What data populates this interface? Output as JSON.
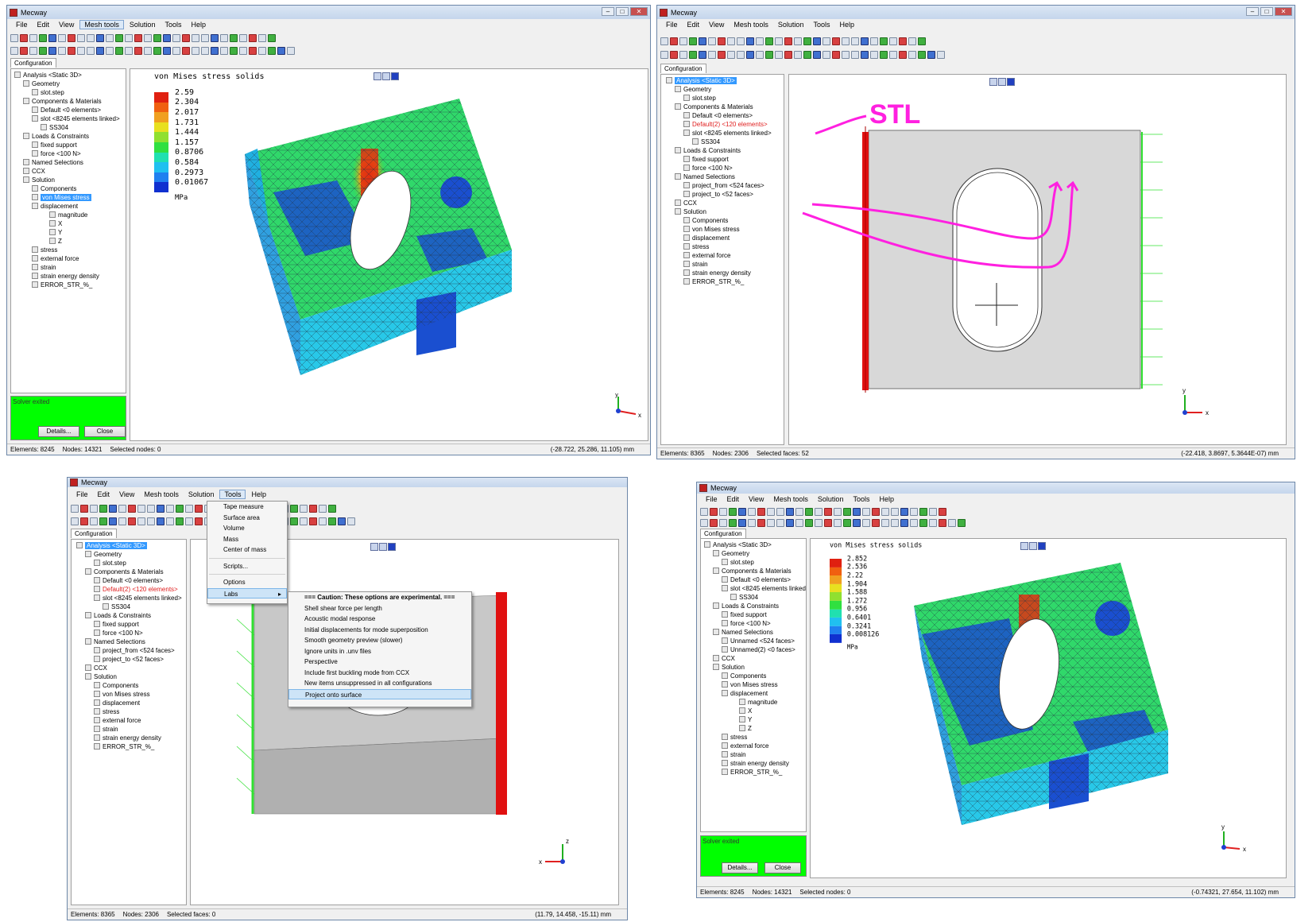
{
  "app_title": "Mecway",
  "menus": [
    "File",
    "Edit",
    "View",
    "Mesh tools",
    "Solution",
    "Tools",
    "Help"
  ],
  "config_tab": "Configuration",
  "win_controls": {
    "min": "–",
    "max": "□",
    "close": "✕"
  },
  "tree_a": [
    {
      "label": "Analysis <Static 3D>",
      "icon": "analysis"
    },
    {
      "label": "Geometry",
      "icon": "folder"
    },
    {
      "label": "slot.step",
      "icon": "geom"
    },
    {
      "label": "Components & Materials",
      "icon": "folder"
    },
    {
      "label": "Default <0 elements>",
      "icon": "mesh"
    },
    {
      "label": "slot <8245 elements linked>",
      "icon": "mesh"
    },
    {
      "label": "SS304",
      "icon": "mat"
    },
    {
      "label": "Loads & Constraints",
      "icon": "folder"
    },
    {
      "label": "fixed support",
      "icon": "blue"
    },
    {
      "label": "force <100 N>",
      "icon": "blue"
    },
    {
      "label": "Named Selections",
      "icon": "folder"
    },
    {
      "label": "CCX",
      "icon": "ccx"
    },
    {
      "label": "Solution",
      "icon": "tri"
    },
    {
      "label": "Components",
      "icon": "folder"
    },
    {
      "label": "von Mises stress",
      "icon": "tri",
      "selected": true
    },
    {
      "label": "displacement",
      "icon": "tri"
    },
    {
      "label": "magnitude",
      "icon": "tri"
    },
    {
      "label": "X",
      "icon": "tri"
    },
    {
      "label": "Y",
      "icon": "tri"
    },
    {
      "label": "Z",
      "icon": "tri"
    },
    {
      "label": "stress",
      "icon": "tri"
    },
    {
      "label": "external force",
      "icon": "tri"
    },
    {
      "label": "strain",
      "icon": "tri"
    },
    {
      "label": "strain energy density",
      "icon": "tri"
    },
    {
      "label": "ERROR_STR_%_",
      "icon": "tri"
    }
  ],
  "tree_b": [
    {
      "label": "Analysis <Static 3D>",
      "icon": "analysis",
      "selected": true
    },
    {
      "label": "Geometry",
      "icon": "folder"
    },
    {
      "label": "slot.step",
      "icon": "geom"
    },
    {
      "label": "Components & Materials",
      "icon": "folder"
    },
    {
      "label": "Default <0 elements>",
      "icon": "mesh"
    },
    {
      "label": "Default(2) <120 elements>",
      "icon": "mesh",
      "red": true
    },
    {
      "label": "slot <8245 elements linked>",
      "icon": "mesh"
    },
    {
      "label": "SS304",
      "icon": "mat"
    },
    {
      "label": "Loads & Constraints",
      "icon": "folder"
    },
    {
      "label": "fixed support",
      "icon": "blue"
    },
    {
      "label": "force <100 N>",
      "icon": "blue"
    },
    {
      "label": "Named Selections",
      "icon": "folder"
    },
    {
      "label": "project_from <524 faces>",
      "icon": "mesh"
    },
    {
      "label": "project_to <52 faces>",
      "icon": "mesh"
    },
    {
      "label": "CCX",
      "icon": "ccx"
    },
    {
      "label": "Solution",
      "icon": "tri"
    },
    {
      "label": "Components",
      "icon": "folder"
    },
    {
      "label": "von Mises stress",
      "icon": "tri"
    },
    {
      "label": "displacement",
      "icon": "tri"
    },
    {
      "label": "stress",
      "icon": "tri"
    },
    {
      "label": "external force",
      "icon": "tri"
    },
    {
      "label": "strain",
      "icon": "tri"
    },
    {
      "label": "strain energy density",
      "icon": "tri"
    },
    {
      "label": "ERROR_STR_%_",
      "icon": "tri"
    }
  ],
  "tree_d": [
    {
      "label": "Analysis <Static 3D>",
      "icon": "analysis"
    },
    {
      "label": "Geometry",
      "icon": "folder"
    },
    {
      "label": "slot.step",
      "icon": "geom"
    },
    {
      "label": "Components & Materials",
      "icon": "folder"
    },
    {
      "label": "Default <0 elements>",
      "icon": "mesh"
    },
    {
      "label": "slot <8245 elements linked>",
      "icon": "mesh"
    },
    {
      "label": "SS304",
      "icon": "mat"
    },
    {
      "label": "Loads & Constraints",
      "icon": "folder"
    },
    {
      "label": "fixed support",
      "icon": "blue"
    },
    {
      "label": "force <100 N>",
      "icon": "blue"
    },
    {
      "label": "Named Selections",
      "icon": "folder"
    },
    {
      "label": "Unnamed <524 faces>",
      "icon": "mesh"
    },
    {
      "label": "Unnamed(2) <0 faces>",
      "icon": "mesh"
    },
    {
      "label": "CCX",
      "icon": "ccx"
    },
    {
      "label": "Solution",
      "icon": "tri"
    },
    {
      "label": "Components",
      "icon": "folder"
    },
    {
      "label": "von Mises stress",
      "icon": "tri"
    },
    {
      "label": "displacement",
      "icon": "tri"
    },
    {
      "label": "magnitude",
      "icon": "tri"
    },
    {
      "label": "X",
      "icon": "tri"
    },
    {
      "label": "Y",
      "icon": "tri"
    },
    {
      "label": "Z",
      "icon": "tri"
    },
    {
      "label": "stress",
      "icon": "tri"
    },
    {
      "label": "external force",
      "icon": "tri"
    },
    {
      "label": "strain",
      "icon": "tri"
    },
    {
      "label": "strain energy density",
      "icon": "tri"
    },
    {
      "label": "ERROR_STR_%_",
      "icon": "tri"
    }
  ],
  "legend_a": {
    "title": "von Mises stress solids",
    "values": [
      "2.59",
      "2.304",
      "2.017",
      "1.731",
      "1.444",
      "1.157",
      "0.8706",
      "0.584",
      "0.2973",
      "0.01067"
    ],
    "unit": "MPa"
  },
  "legend_d": {
    "title": "von Mises stress solids",
    "values": [
      "2.852",
      "2.536",
      "2.22",
      "1.904",
      "1.588",
      "1.272",
      "0.956",
      "0.6401",
      "0.3241",
      "0.008126"
    ],
    "unit": "MPa"
  },
  "legend_colors": [
    "#e02010",
    "#f06010",
    "#f0a020",
    "#e8e020",
    "#90e030",
    "#30e040",
    "#20e0b0",
    "#20c0f0",
    "#2080f0",
    "#1030d0"
  ],
  "solver": {
    "label": "Solver exited",
    "details": "Details...",
    "close": "Close"
  },
  "status_a": {
    "elements": "Elements: 8245",
    "nodes": "Nodes: 14321",
    "selected": "Selected nodes: 0",
    "coord": "(-28.722, 25.286, 11.105) mm"
  },
  "status_b": {
    "elements": "Elements: 8365",
    "nodes": "Nodes: 2306",
    "selected": "Selected faces: 52",
    "coord": "(-22.418, 3.8697, 5.3644E-07) mm"
  },
  "status_c": {
    "elements": "Elements: 8365",
    "nodes": "Nodes: 2306",
    "selected": "Selected faces: 0",
    "coord": "(11.79, 14.458, -15.11) mm"
  },
  "status_d": {
    "elements": "Elements: 8245",
    "nodes": "Nodes: 14321",
    "selected": "Selected nodes: 0",
    "coord": "(-0.74321, 27.654, 11.102) mm"
  },
  "annotation": "STL",
  "tools_menu": [
    "Tape measure",
    "Surface area",
    "Volume",
    "Mass",
    "Center of mass",
    "Scripts...",
    "Options",
    "Labs"
  ],
  "labs_menu": [
    "=== Caution: These options are experimental. ===",
    "Shell shear force per length",
    "Acoustic modal response",
    "Initial displacements for mode superposition",
    "Smooth geometry preview (slower)",
    "Ignore units in .unv files",
    "Perspective",
    "Include first buckling mode from CCX",
    "New items unsuppressed in all configurations",
    "Project onto surface"
  ],
  "axis": {
    "x": "x",
    "y": "y",
    "z": "z"
  }
}
